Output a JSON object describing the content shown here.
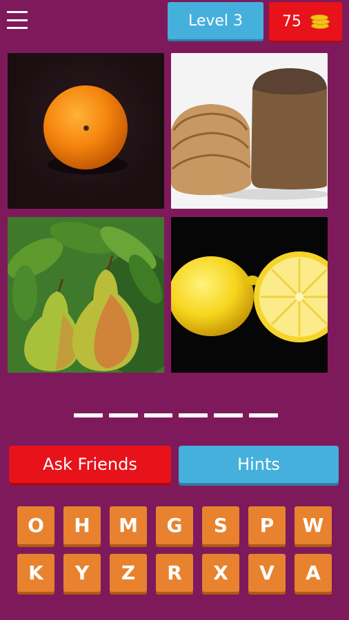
{
  "header": {
    "level_label": "Level 3",
    "coins": "75"
  },
  "images": [
    {
      "subject": "orange"
    },
    {
      "subject": "bread"
    },
    {
      "subject": "pears"
    },
    {
      "subject": "lemon"
    }
  ],
  "answer_slots": 6,
  "buttons": {
    "ask_friends": "Ask Friends",
    "hints": "Hints"
  },
  "letters": [
    "O",
    "H",
    "M",
    "G",
    "S",
    "P",
    "W",
    "K",
    "Y",
    "Z",
    "R",
    "X",
    "V",
    "A"
  ],
  "colors": {
    "background": "#7e1a5b",
    "blue": "#46b0dc",
    "red": "#e8121a",
    "key_orange": "#e8822e"
  }
}
